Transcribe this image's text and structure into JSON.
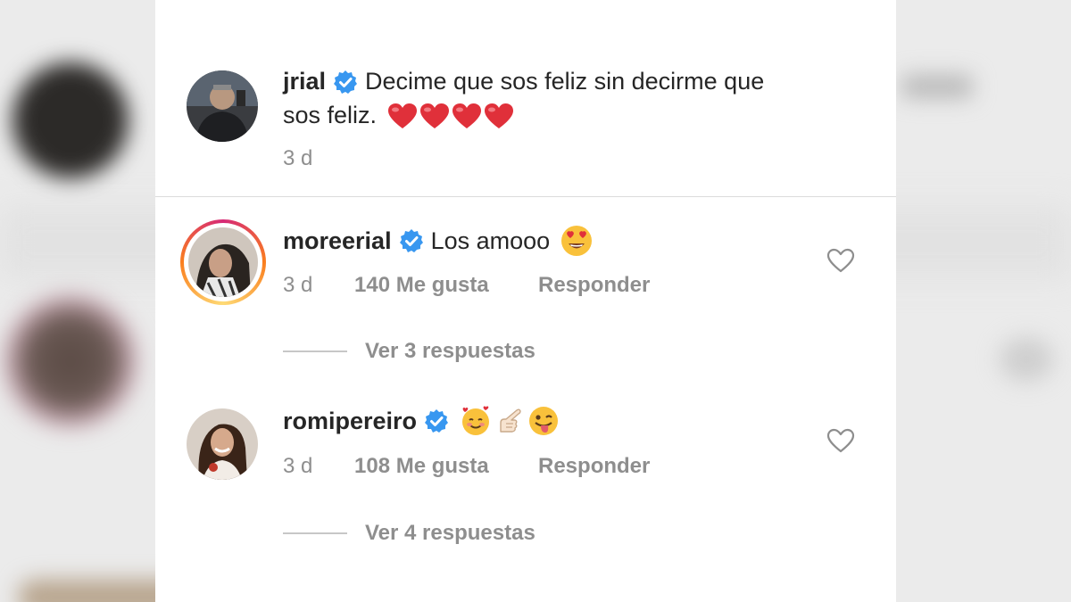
{
  "post": {
    "username": "jrial",
    "verified": true,
    "caption_line1": "Decime que sos feliz sin decirme que",
    "caption_line2": "sos feliz.",
    "caption_emojis": [
      "red-heart",
      "red-heart",
      "red-heart",
      "red-heart"
    ],
    "time": "3 d"
  },
  "comments": [
    {
      "username": "moreerial",
      "verified": true,
      "text": "Los amooo",
      "emojis": [
        "heart-eyes-face"
      ],
      "time": "3 d",
      "likes": "140 Me gusta",
      "reply_label": "Responder",
      "view_replies": "Ver 3 respuestas",
      "story_ring": true
    },
    {
      "username": "romipereiro",
      "verified": true,
      "text": "",
      "emojis": [
        "smiling-face-with-hearts",
        "pointing-hand",
        "winking-tongue-face"
      ],
      "time": "3 d",
      "likes": "108 Me gusta",
      "reply_label": "Responder",
      "view_replies": "Ver 4 respuestas",
      "story_ring": false
    }
  ],
  "colors": {
    "verified_blue": "#3897f0",
    "meta_gray": "#8e8e8e",
    "heart_red": "#e0303a"
  }
}
